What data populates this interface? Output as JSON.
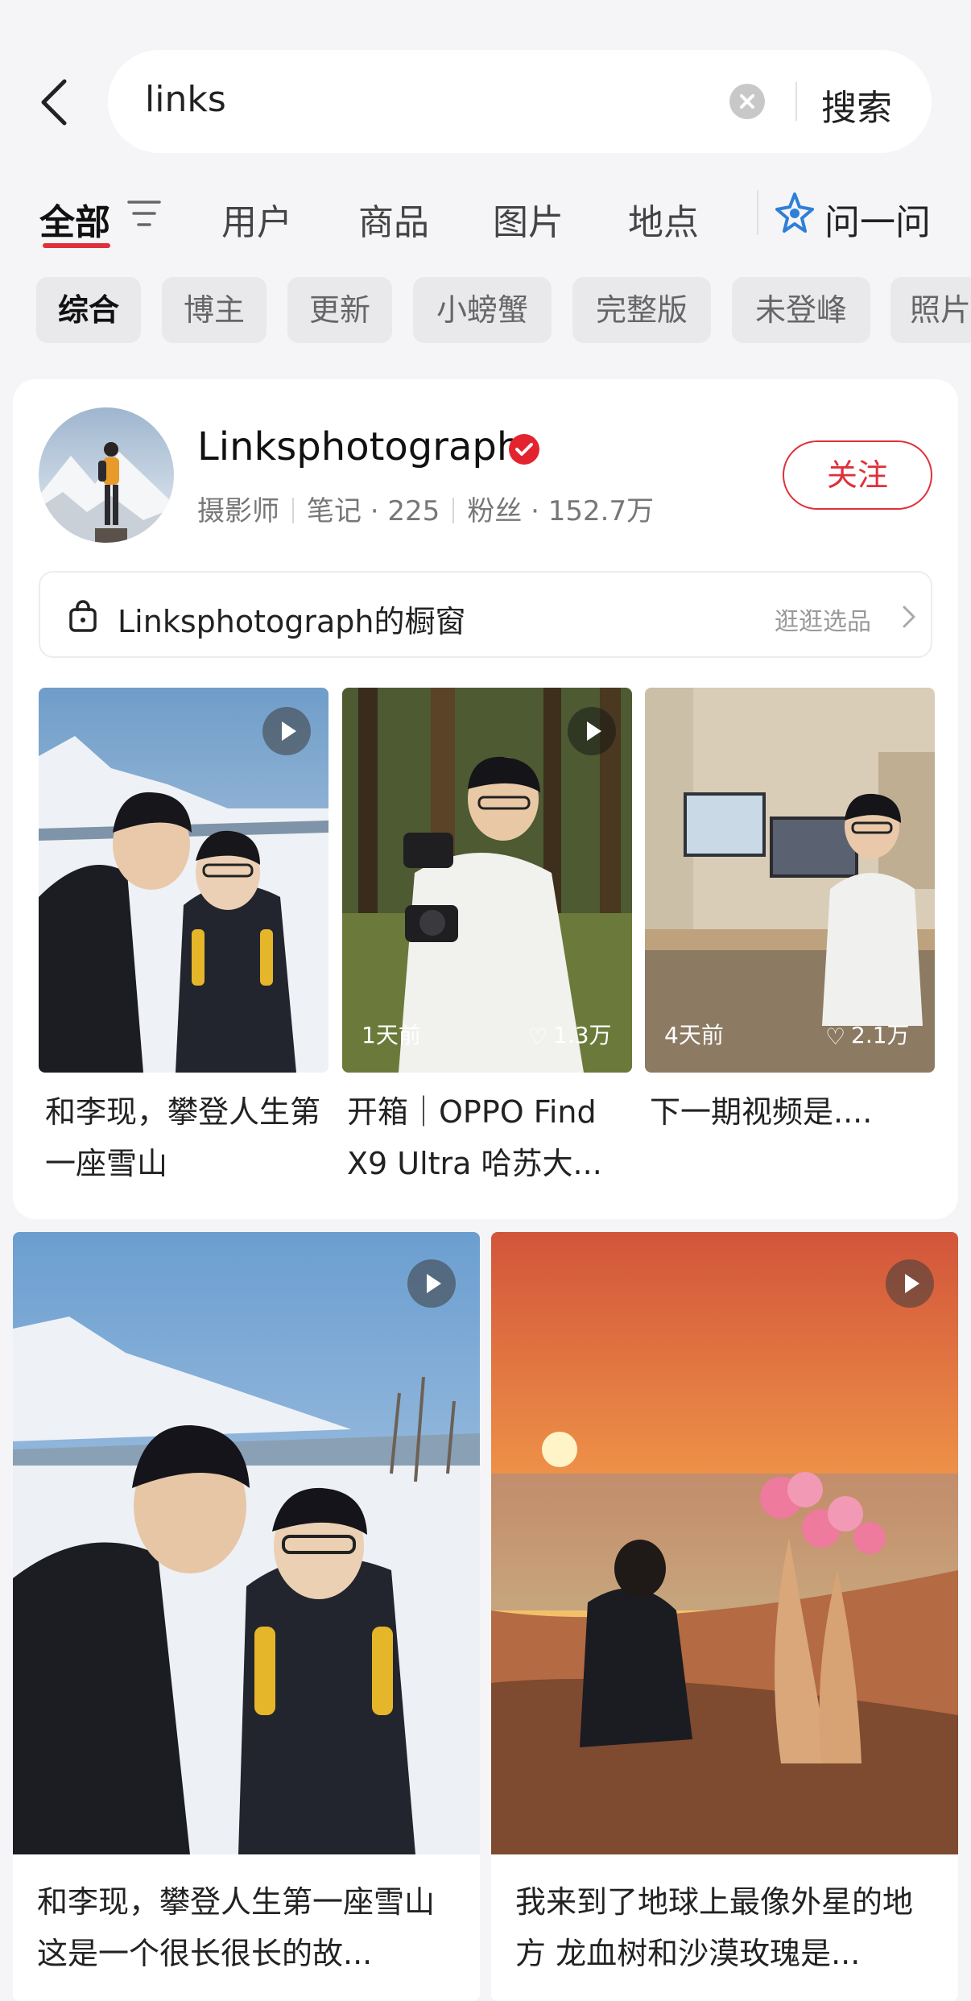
{
  "search": {
    "query": "links",
    "submit_label": "搜索"
  },
  "tabs": [
    {
      "label": "全部"
    },
    {
      "label": "用户"
    },
    {
      "label": "商品"
    },
    {
      "label": "图片"
    },
    {
      "label": "地点"
    },
    {
      "label": "问一问"
    }
  ],
  "chips": [
    "综合",
    "博主",
    "更新",
    "小螃蟹",
    "完整版",
    "未登峰",
    "照片"
  ],
  "user": {
    "name": "Linksphotograph",
    "role": "摄影师",
    "notes": "笔记 · 225",
    "fans": "粉丝 · 152.7万",
    "follow_label": "关注"
  },
  "shop": {
    "title": "Linksphotograph的橱窗",
    "more_label": "逛逛选品"
  },
  "user_posts": [
    {
      "caption": "和李现，攀登人生第一座雪山",
      "time": "",
      "likes": ""
    },
    {
      "caption": "开箱｜OPPO Find X9 Ultra 哈苏大...",
      "time": "1天前",
      "likes": "1.3万"
    },
    {
      "caption": "下一期视频是....",
      "time": "4天前",
      "likes": "2.1万"
    }
  ],
  "feed": [
    {
      "caption": "和李现，攀登人生第一座雪山 这是一个很长很长的故..."
    },
    {
      "caption": "我来到了地球上最像外星的地方 龙血树和沙漠玫瑰是..."
    }
  ],
  "colors": {
    "accent": "#e0303a",
    "ask_icon": "#2f7fd8"
  }
}
